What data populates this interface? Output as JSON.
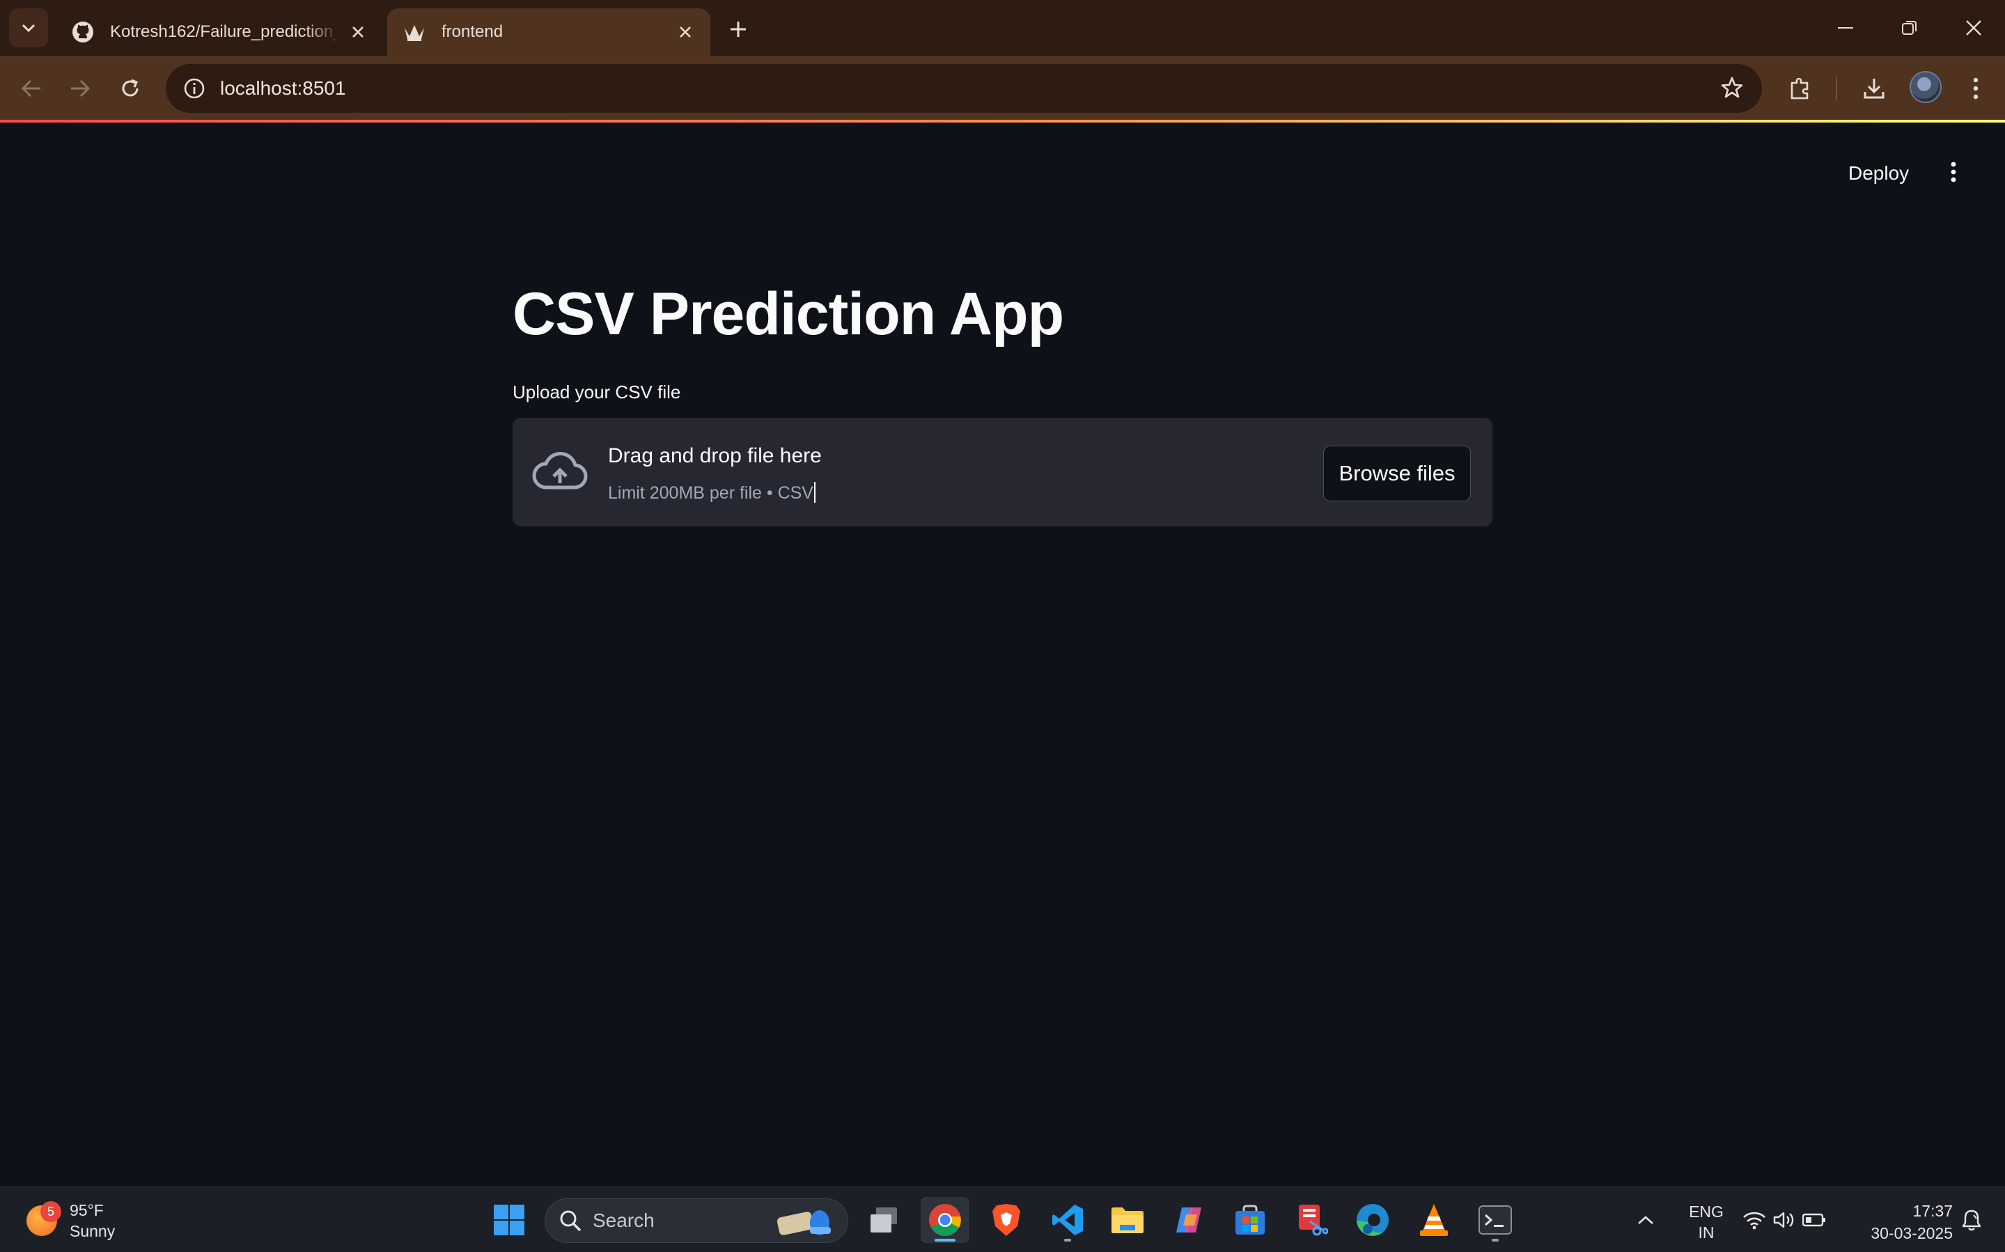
{
  "browser": {
    "tabs": [
      {
        "title": "Kotresh162/Failure_prediction_model",
        "icon": "github-icon",
        "active": false
      },
      {
        "title": "frontend",
        "icon": "streamlit-icon",
        "active": true
      }
    ],
    "url": "localhost:8501"
  },
  "app": {
    "deploy_label": "Deploy",
    "title": "CSV Prediction App",
    "uploader": {
      "label": "Upload your CSV file",
      "instructions": "Drag and drop file here",
      "limit": "Limit 200MB per file • CSV",
      "browse_label": "Browse files"
    }
  },
  "taskbar": {
    "weather": {
      "temp": "95°F",
      "condition": "Sunny",
      "badge": "5"
    },
    "search_placeholder": "Search",
    "lang_line1": "ENG",
    "lang_line2": "IN",
    "time": "17:37",
    "date": "30-03-2025",
    "apps": [
      "start-icon",
      "search",
      "task-view-icon",
      "chrome-icon",
      "brave-icon",
      "vscode-icon",
      "file-explorer-icon",
      "copilot-icon",
      "microsoft-store-icon",
      "snipping-tool-icon",
      "edge-icon",
      "vlc-icon",
      "terminal-icon"
    ]
  },
  "colors": {
    "app_bg": "#0e1117",
    "dropzone_bg": "#262730",
    "browser_frame": "#2e1b12",
    "browser_toolbar": "#50331f",
    "accent_gradient_start": "#ff4b4b",
    "accent_gradient_end": "#fffd80"
  }
}
